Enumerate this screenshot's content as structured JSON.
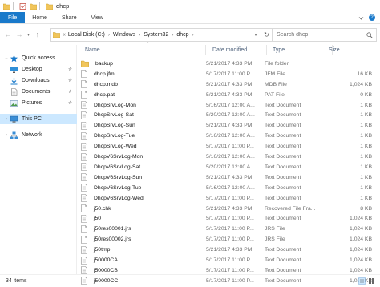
{
  "window": {
    "title": "dhcp"
  },
  "ribbon": {
    "tabs": [
      "File",
      "Home",
      "Share",
      "View"
    ]
  },
  "address": {
    "prefix": "«",
    "crumbs": [
      "Local Disk (C:)",
      "Windows",
      "System32",
      "dhcp"
    ]
  },
  "search": {
    "placeholder": "Search dhcp"
  },
  "sidebar": {
    "items": [
      {
        "label": "Quick access",
        "icon": "star-icon"
      },
      {
        "label": "Desktop",
        "icon": "desktop-icon",
        "pinned": true
      },
      {
        "label": "Downloads",
        "icon": "download-icon",
        "pinned": true
      },
      {
        "label": "Documents",
        "icon": "documents-icon",
        "pinned": true
      },
      {
        "label": "Pictures",
        "icon": "pictures-icon",
        "pinned": true
      },
      {
        "label": "This PC",
        "icon": "computer-icon",
        "selected": true
      },
      {
        "label": "Network",
        "icon": "network-icon"
      }
    ]
  },
  "columns": [
    "Name",
    "Date modified",
    "Type",
    "Size"
  ],
  "files": [
    {
      "name": "backup",
      "date": "5/21/2017 4:33 PM",
      "type": "File folder",
      "size": "",
      "icon": "folder-icon"
    },
    {
      "name": "dhcp.jfm",
      "date": "5/17/2017 11:00 P...",
      "type": "JFM File",
      "size": "16 KB",
      "icon": "file-icon"
    },
    {
      "name": "dhcp.mdb",
      "date": "5/21/2017 4:33 PM",
      "type": "MDB File",
      "size": "1,024 KB",
      "icon": "file-icon"
    },
    {
      "name": "dhcp.pat",
      "date": "5/21/2017 4:33 PM",
      "type": "PAT File",
      "size": "0 KB",
      "icon": "file-icon"
    },
    {
      "name": "DhcpSrvLog-Mon",
      "date": "5/16/2017 12:00 A...",
      "type": "Text Document",
      "size": "1 KB",
      "icon": "text-file-icon"
    },
    {
      "name": "DhcpSrvLog-Sat",
      "date": "5/20/2017 12:00 A...",
      "type": "Text Document",
      "size": "1 KB",
      "icon": "text-file-icon"
    },
    {
      "name": "DhcpSrvLog-Sun",
      "date": "5/21/2017 4:33 PM",
      "type": "Text Document",
      "size": "1 KB",
      "icon": "text-file-icon"
    },
    {
      "name": "DhcpSrvLog-Tue",
      "date": "5/16/2017 12:00 A...",
      "type": "Text Document",
      "size": "1 KB",
      "icon": "text-file-icon"
    },
    {
      "name": "DhcpSrvLog-Wed",
      "date": "5/17/2017 11:00 P...",
      "type": "Text Document",
      "size": "1 KB",
      "icon": "text-file-icon"
    },
    {
      "name": "DhcpV6SrvLog-Mon",
      "date": "5/16/2017 12:00 A...",
      "type": "Text Document",
      "size": "1 KB",
      "icon": "text-file-icon"
    },
    {
      "name": "DhcpV6SrvLog-Sat",
      "date": "5/20/2017 12:00 A...",
      "type": "Text Document",
      "size": "1 KB",
      "icon": "text-file-icon"
    },
    {
      "name": "DhcpV6SrvLog-Sun",
      "date": "5/21/2017 4:33 PM",
      "type": "Text Document",
      "size": "1 KB",
      "icon": "text-file-icon"
    },
    {
      "name": "DhcpV6SrvLog-Tue",
      "date": "5/16/2017 12:00 A...",
      "type": "Text Document",
      "size": "1 KB",
      "icon": "text-file-icon"
    },
    {
      "name": "DhcpV6SrvLog-Wed",
      "date": "5/17/2017 11:00 P...",
      "type": "Text Document",
      "size": "1 KB",
      "icon": "text-file-icon"
    },
    {
      "name": "j50.chk",
      "date": "5/21/2017 4:33 PM",
      "type": "Recovered File Fra...",
      "size": "8 KB",
      "icon": "file-icon"
    },
    {
      "name": "j50",
      "date": "5/17/2017 11:00 P...",
      "type": "Text Document",
      "size": "1,024 KB",
      "icon": "text-file-icon"
    },
    {
      "name": "j50res00001.jrs",
      "date": "5/17/2017 11:00 P...",
      "type": "JRS File",
      "size": "1,024 KB",
      "icon": "file-icon"
    },
    {
      "name": "j50res00002.jrs",
      "date": "5/17/2017 11:00 P...",
      "type": "JRS File",
      "size": "1,024 KB",
      "icon": "file-icon"
    },
    {
      "name": "j50tmp",
      "date": "5/21/2017 4:33 PM",
      "type": "Text Document",
      "size": "1,024 KB",
      "icon": "text-file-icon"
    },
    {
      "name": "j50000CA",
      "date": "5/17/2017 11:00 P...",
      "type": "Text Document",
      "size": "1,024 KB",
      "icon": "text-file-icon"
    },
    {
      "name": "j50000CB",
      "date": "5/17/2017 11:00 P...",
      "type": "Text Document",
      "size": "1,024 KB",
      "icon": "text-file-icon"
    },
    {
      "name": "j50000CC",
      "date": "5/17/2017 11:00 P...",
      "type": "Text Document",
      "size": "1,024 KB",
      "icon": "text-file-icon"
    }
  ],
  "status": {
    "item_count": "34 items"
  },
  "colors": {
    "accent": "#1979ca",
    "selection": "#cce8ff",
    "folder": "#f1c55a",
    "header_text": "#4c607a"
  }
}
